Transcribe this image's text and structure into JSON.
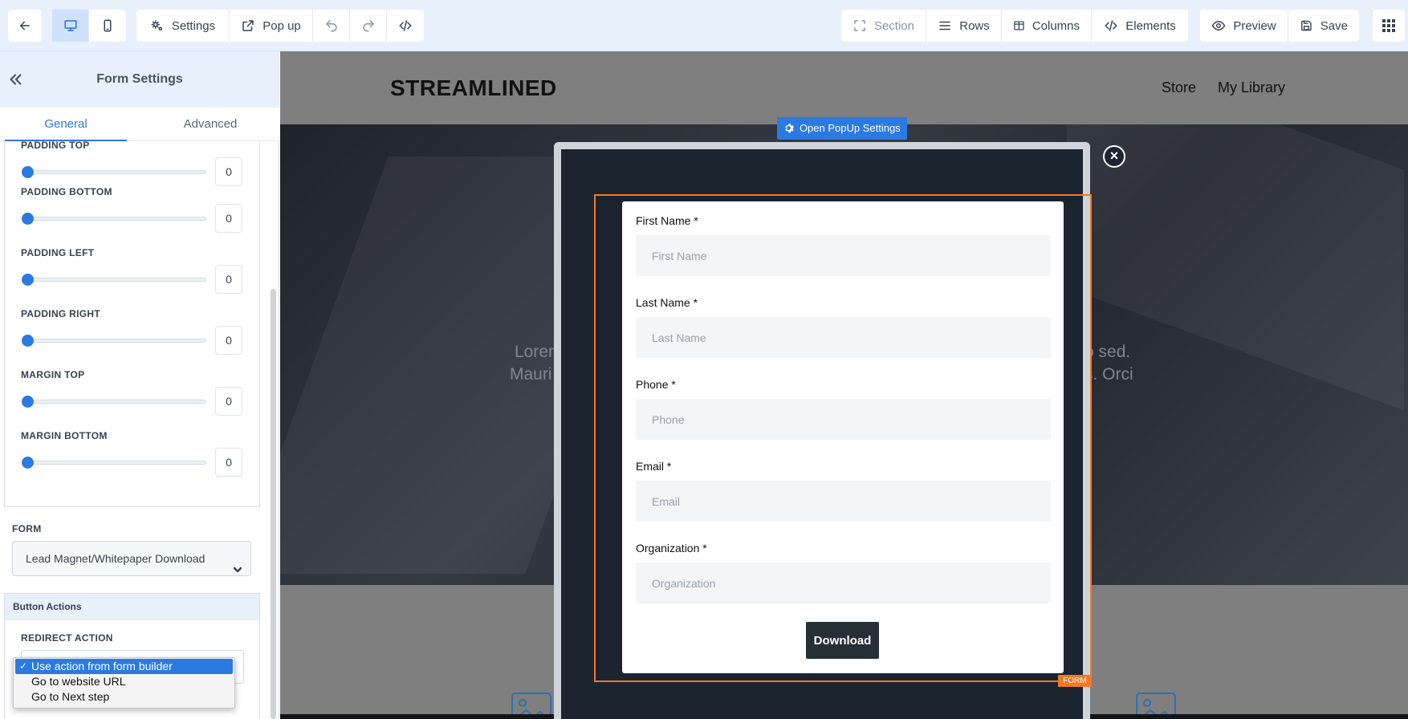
{
  "toolbar": {
    "settings_label": "Settings",
    "popup_label": "Pop up",
    "section_label": "Section",
    "rows_label": "Rows",
    "columns_label": "Columns",
    "elements_label": "Elements",
    "preview_label": "Preview",
    "save_label": "Save"
  },
  "panel": {
    "title": "Form Settings",
    "tabs": [
      {
        "label": "General",
        "active": true
      },
      {
        "label": "Advanced",
        "active": false
      }
    ],
    "cut_label": "PADDING TOP",
    "sliders": [
      {
        "label": "",
        "value": "0"
      },
      {
        "label": "PADDING BOTTOM",
        "value": "0"
      },
      {
        "label": "PADDING LEFT",
        "value": "0"
      },
      {
        "label": "PADDING RIGHT",
        "value": "0"
      },
      {
        "label": "MARGIN TOP",
        "value": "0"
      },
      {
        "label": "MARGIN BOTTOM",
        "value": "0"
      }
    ],
    "form_label": "FORM",
    "form_value": "Lead Magnet/Whitepaper Download",
    "button_actions_title": "Button Actions",
    "redirect_label": "REDIRECT ACTION",
    "redirect_options": [
      {
        "label": "Use action from form builder",
        "selected": true
      },
      {
        "label": "Go to website URL",
        "selected": false
      },
      {
        "label": "Go to Next step",
        "selected": false
      }
    ]
  },
  "site": {
    "logo": "STREAMLINED",
    "nav": [
      "Store",
      "My Library"
    ],
    "hero_text_left_1": "Lorem",
    "hero_text_left_2": "Mauri",
    "hero_text_right_1": "o sed.",
    "hero_text_right_2": "s. Orci"
  },
  "popup": {
    "open_settings_label": "Open PopUp Settings",
    "close_symbol": "×",
    "form_tag": "FORM",
    "fields": [
      {
        "label": "First Name *",
        "placeholder": "First Name"
      },
      {
        "label": "Last Name *",
        "placeholder": "Last Name"
      },
      {
        "label": "Phone *",
        "placeholder": "Phone"
      },
      {
        "label": "Email *",
        "placeholder": "Email"
      },
      {
        "label": "Organization *",
        "placeholder": "Organization"
      }
    ],
    "submit_label": "Download"
  },
  "colors": {
    "accent": "#2a7ae2",
    "form_outline": "#f07a26",
    "popup_bg": "#1c2430",
    "toolbar_bg": "#e7f0fb"
  }
}
